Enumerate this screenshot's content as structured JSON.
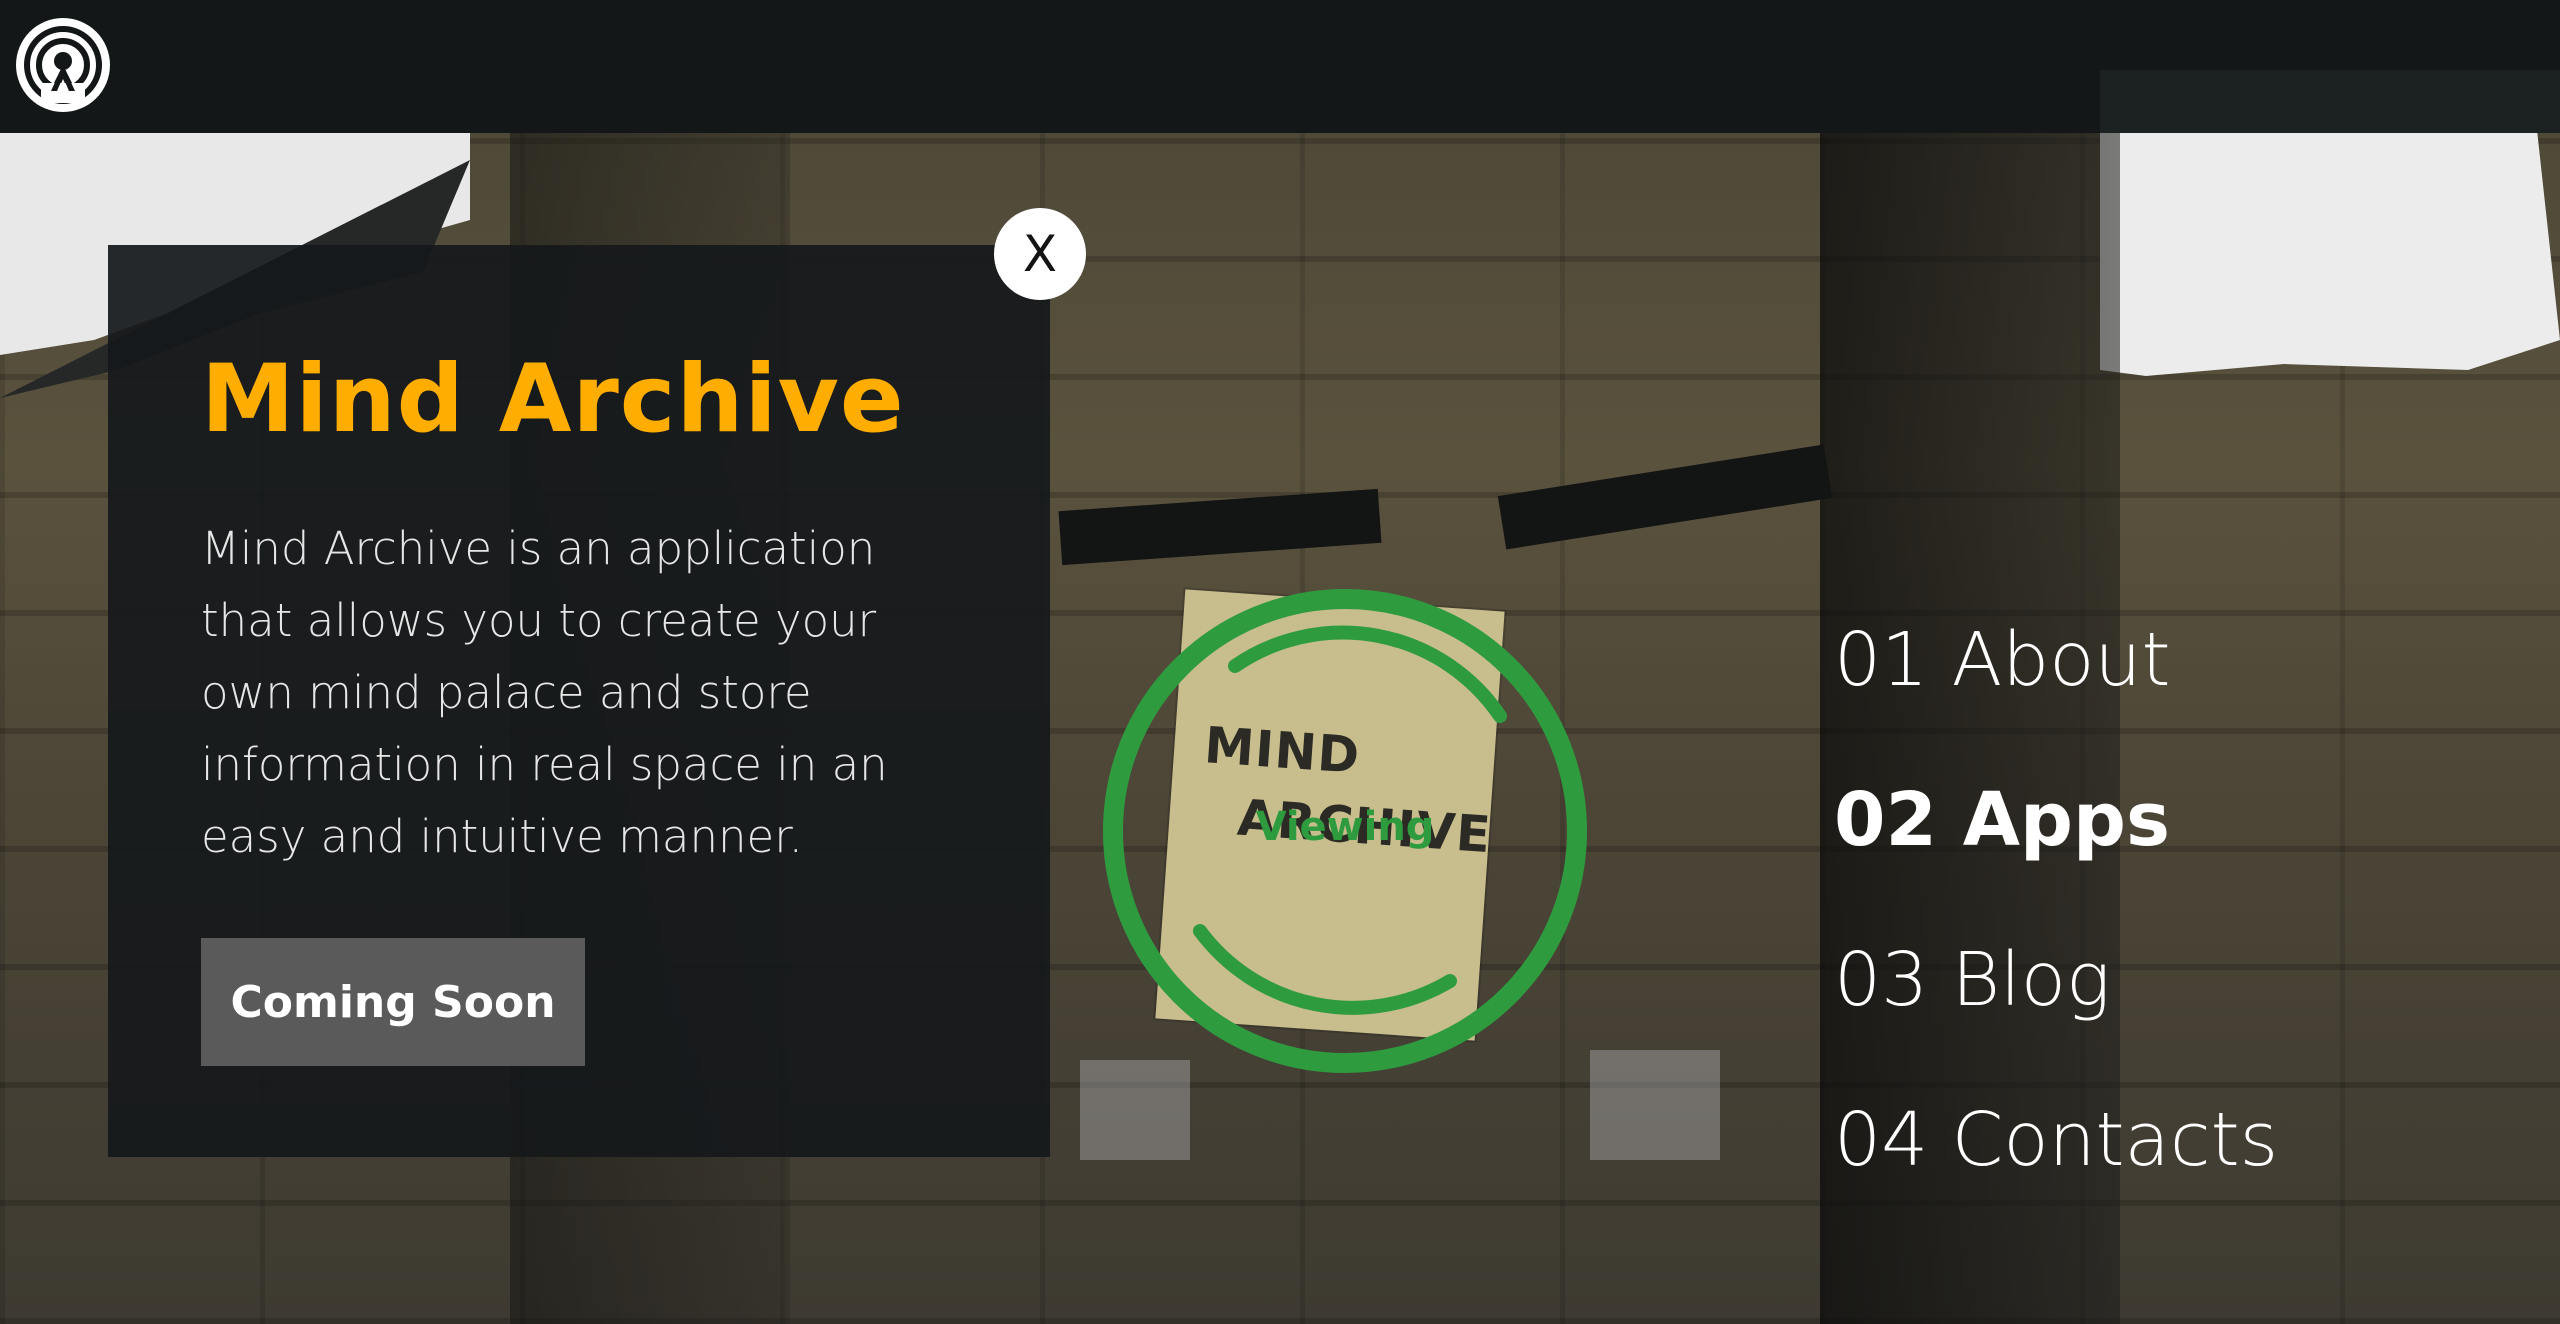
{
  "header": {
    "logo_icon": "signal-tower-icon"
  },
  "card": {
    "title": "Mind Archive",
    "description": "Mind Archive is an application that allows you to create your own mind palace and store information in real space in an easy and intuitive manner.",
    "button_label": "Coming Soon",
    "close_label": "X",
    "title_color": "#ffad00"
  },
  "poster": {
    "line1": "MIND",
    "line2": "ARCHIVE"
  },
  "viewer": {
    "status_label": "Viewing",
    "ring_color": "#2f9b3f"
  },
  "nav": {
    "items": [
      {
        "label": "01 About",
        "active": false
      },
      {
        "label": "02 Apps",
        "active": true
      },
      {
        "label": "03 Blog",
        "active": false
      },
      {
        "label": "04 Contacts",
        "active": false
      }
    ]
  }
}
